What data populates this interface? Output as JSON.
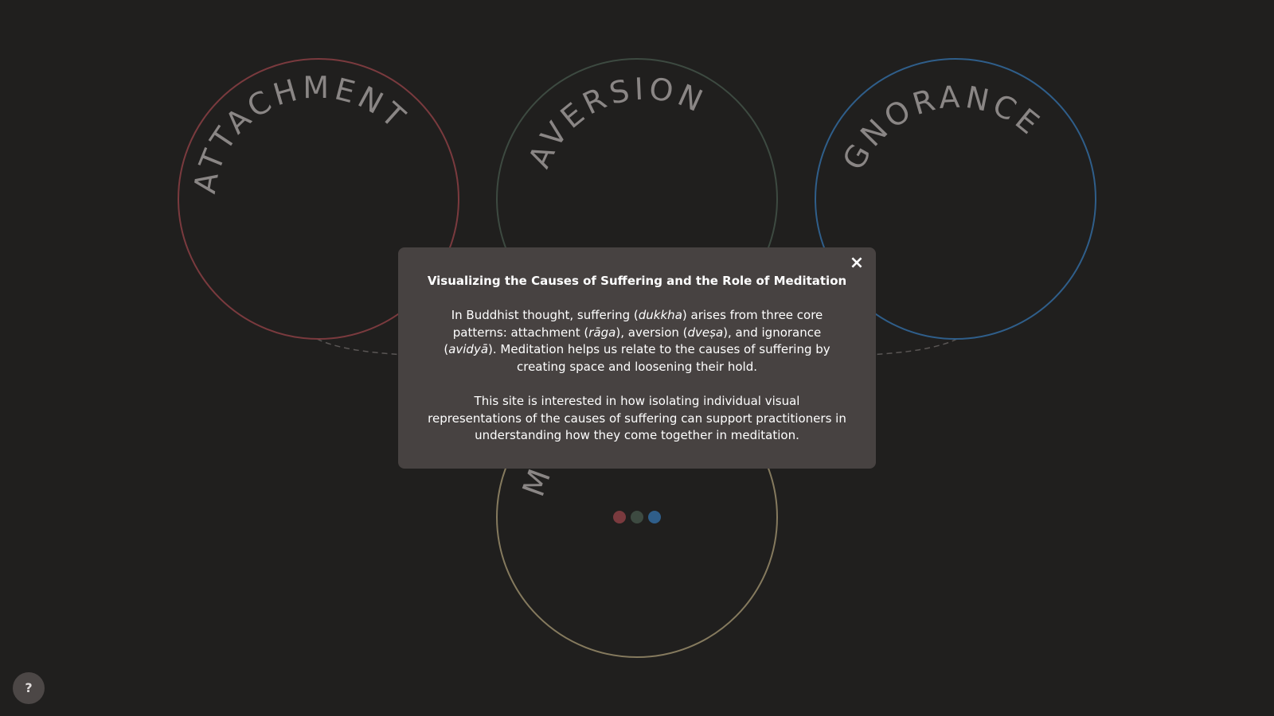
{
  "circles": [
    {
      "label": "ATTACHMENT",
      "color": "#7a3a3e"
    },
    {
      "label": "AVERSION",
      "color": "#3d4a41"
    },
    {
      "label": "IGNORANCE",
      "color": "#2f5e8a"
    },
    {
      "label": "MEDITATION",
      "color": "#857a5e"
    }
  ],
  "center_dots": [
    "#7a3a3e",
    "#3d4a41",
    "#2f5e8a"
  ],
  "connector_color": "#5a5655",
  "modal": {
    "title": "Visualizing the Causes of Suffering and the Role of Meditation",
    "paragraph1": {
      "t1": "In Buddhist thought, suffering (",
      "e1": "dukkha",
      "t2": ") arises from three core patterns: attachment (",
      "e2": "rāga",
      "t3": "), aversion (",
      "e3": "dveṣa",
      "t4": "), and ignorance (",
      "e4": "avidyā",
      "t5": "). Meditation helps us relate to the causes of suffering by creating space and loosening their hold."
    },
    "paragraph2": "This site is interested in how isolating individual visual representations of the causes of suffering can support practitioners in understanding how they come together in meditation.",
    "close_symbol": "×"
  },
  "help_button": {
    "label": "?"
  }
}
